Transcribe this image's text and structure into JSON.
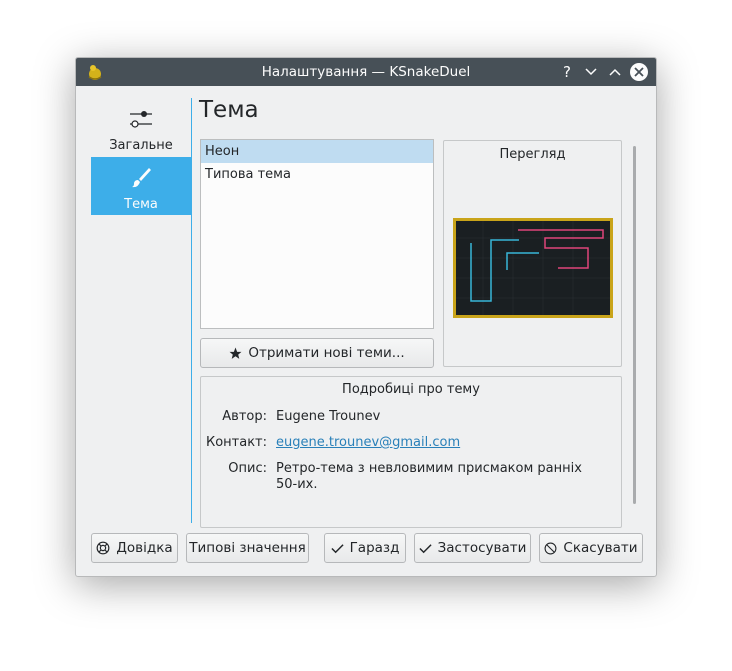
{
  "window": {
    "title": "Налаштування — KSnakeDuel",
    "controls": [
      "?",
      "minimize",
      "maximize",
      "close"
    ]
  },
  "sidebar": {
    "items": [
      {
        "label": "Загальне",
        "icon": "sliders-icon",
        "active": false
      },
      {
        "label": "Тема",
        "icon": "brush-icon",
        "active": true
      }
    ]
  },
  "page": {
    "title": "Тема",
    "themes": [
      "Неон",
      "Типова тема"
    ],
    "selected_theme": "Неон",
    "get_new_label": "Отримати нові теми...",
    "preview_title": "Перегляд"
  },
  "details": {
    "title": "Подробиці про тему",
    "author_label": "Автор:",
    "author": "Eugene Trounev",
    "contact_label": "Контакт:",
    "contact": "eugene.trounev@gmail.com",
    "description_label": "Опис:",
    "description": "Ретро-тема з невловимим присмаком ранніх 50-их."
  },
  "buttons": {
    "help": "Довідка",
    "defaults": "Типові значення",
    "ok": "Гаразд",
    "apply": "Застосувати",
    "cancel": "Скасувати"
  },
  "colors": {
    "accent": "#3daee9",
    "titlebar": "#475057",
    "selection": "#bfdcf1",
    "link": "#2980b9"
  }
}
